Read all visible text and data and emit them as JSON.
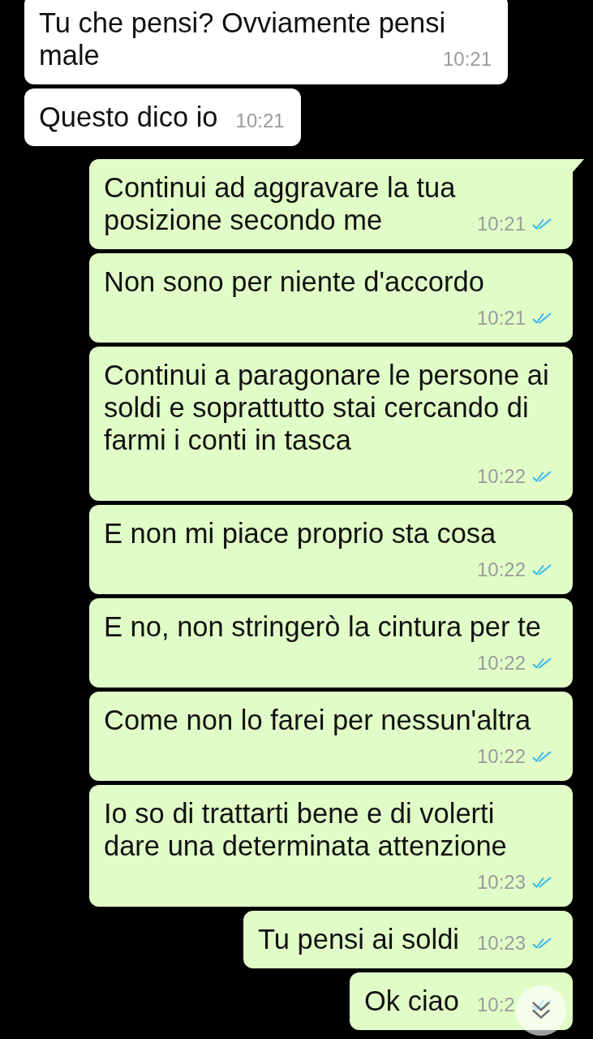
{
  "messages": [
    {
      "kind": "incoming",
      "text": "Tu che pensi? Ovviamente pensi male",
      "time": "10:21"
    },
    {
      "kind": "incoming",
      "text": "Questo dico io",
      "time": "10:21"
    },
    {
      "kind": "outgoing",
      "text": "Continui ad aggravare la tua posizione secondo me",
      "time": "10:21",
      "read": true
    },
    {
      "kind": "outgoing",
      "text": "Non sono per niente d'accordo",
      "time": "10:21",
      "read": true
    },
    {
      "kind": "outgoing",
      "text": "Continui a paragonare le persone ai soldi e soprattutto stai cercando di farmi i conti in tasca",
      "time": "10:22",
      "read": true
    },
    {
      "kind": "outgoing",
      "text": "E non mi piace proprio sta cosa",
      "time": "10:22",
      "read": true
    },
    {
      "kind": "outgoing",
      "text": "E no, non stringerò la cintura per te",
      "time": "10:22",
      "read": true
    },
    {
      "kind": "outgoing",
      "text": "Come non lo farei per nessun'altra",
      "time": "10:22",
      "read": true
    },
    {
      "kind": "outgoing",
      "text": "Io so di trattarti bene e di volerti dare una determinata attenzione",
      "time": "10:23",
      "read": true
    },
    {
      "kind": "outgoing",
      "text": "Tu pensi ai soldi",
      "time": "10:23",
      "read": true
    },
    {
      "kind": "outgoing",
      "text": "Ok ciao",
      "time": "10:2",
      "read": true
    }
  ]
}
